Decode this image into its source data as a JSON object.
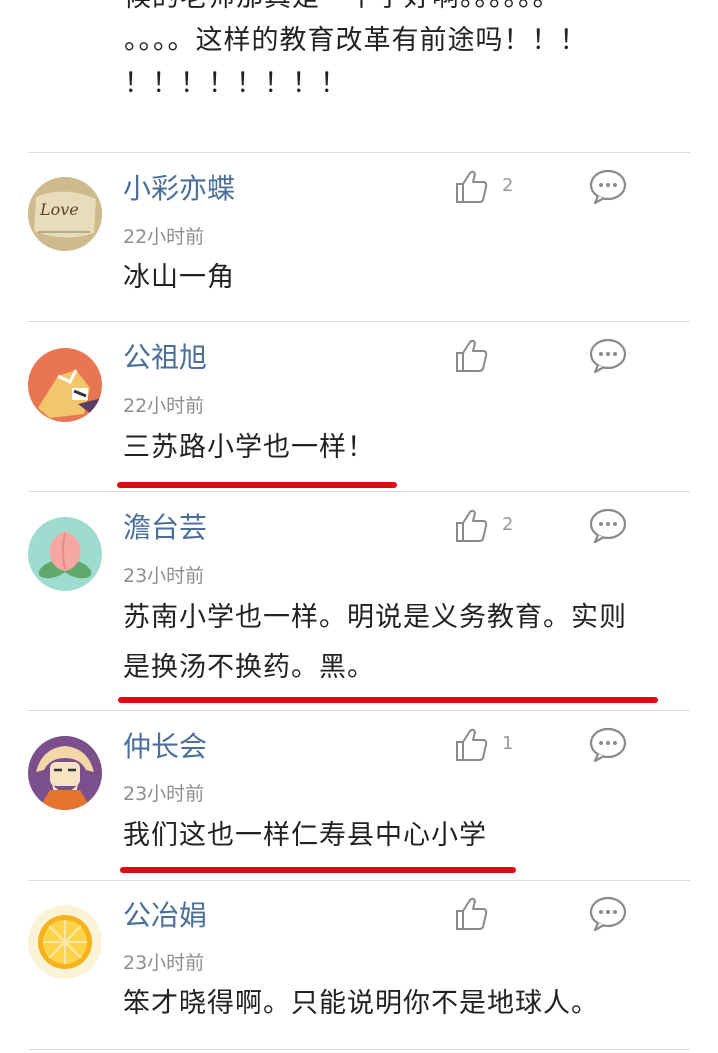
{
  "partial_comment": {
    "lines": [
      "候的老师那真是一个字好啊。。。。。。",
      "。。。。这样的教育改革有前途吗！！！",
      "！！！！！！！！"
    ]
  },
  "comments": [
    {
      "username": "小彩亦蝶",
      "time": "22小时前",
      "content": "冰山一角",
      "likes": "2",
      "avatar_icon": "love-note-avatar"
    },
    {
      "username": "公祖旭",
      "time": "22小时前",
      "content": "三苏路小学也一样！",
      "likes": "",
      "avatar_icon": "cartoon-avatar"
    },
    {
      "username": "澹台芸",
      "time": "23小时前",
      "content_line1": "苏南小学也一样。明说是义务教育。实则",
      "content_line2": "是换汤不换药。黑。",
      "likes": "2",
      "avatar_icon": "peach-avatar"
    },
    {
      "username": "仲长会",
      "time": "23小时前",
      "content": "我们这也一样仁寿县中心小学",
      "likes": "1",
      "avatar_icon": "old-man-avatar"
    },
    {
      "username": "公冶娟",
      "time": "23小时前",
      "content": "笨才晓得啊。只能说明你不是地球人。",
      "likes": "",
      "avatar_icon": "orange-slice-avatar"
    }
  ],
  "colors": {
    "username": "#4a6f9a",
    "timestamp": "#8e8e8e",
    "underline": "#e30613",
    "divider": "#dcdcdc"
  }
}
